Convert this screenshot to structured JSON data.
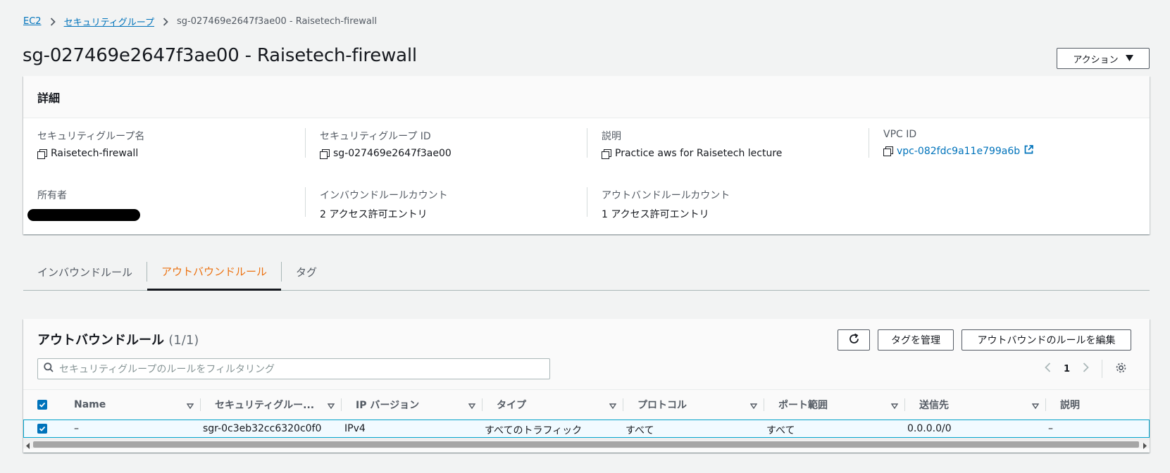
{
  "breadcrumb": {
    "root": "EC2",
    "parent": "セキュリティグループ",
    "current": "sg-027469e2647f3ae00 - Raisetech-firewall"
  },
  "page": {
    "title": "sg-027469e2647f3ae00 - Raisetech-firewall",
    "action_label": "アクション"
  },
  "details": {
    "header": "詳細",
    "fields": {
      "sg_name": {
        "label": "セキュリティグループ名",
        "value": "Raisetech-firewall"
      },
      "sg_id": {
        "label": "セキュリティグループ ID",
        "value": "sg-027469e2647f3ae00"
      },
      "description": {
        "label": "説明",
        "value": "Practice aws for Raisetech lecture"
      },
      "vpc_id": {
        "label": "VPC ID",
        "value": "vpc-082fdc9a11e799a6b"
      },
      "owner": {
        "label": "所有者"
      },
      "inbound_count": {
        "label": "インバウンドルールカウント",
        "value": "2 アクセス許可エントリ"
      },
      "outbound_count": {
        "label": "アウトバンドルールカウント",
        "value": "1 アクセス許可エントリ"
      }
    }
  },
  "tabs": [
    {
      "label": "インバウンドルール",
      "active": false
    },
    {
      "label": "アウトバウンドルール",
      "active": true
    },
    {
      "label": "タグ",
      "active": false
    }
  ],
  "rules": {
    "title": "アウトバウンドルール",
    "count": "(1/1)",
    "manage_tags": "タグを管理",
    "edit_rules": "アウトバウンドのルールを編集",
    "filter_placeholder": "セキュリティグループのルールをフィルタリング",
    "page_number": "1",
    "columns": [
      "Name",
      "セキュリティグルー...",
      "IP バージョン",
      "タイプ",
      "プロトコル",
      "ポート範囲",
      "送信先",
      "説明"
    ],
    "rows": [
      {
        "name": "–",
        "rule_id": "sgr-0c3eb32cc6320c0f0",
        "ip_version": "IPv4",
        "type": "すべてのトラフィック",
        "protocol": "すべて",
        "port_range": "すべて",
        "destination": "0.0.0.0/0",
        "description": "–"
      }
    ]
  },
  "colors": {
    "accent": "#ec7211",
    "link": "#0073bb",
    "selected_border": "#00a1c9"
  }
}
